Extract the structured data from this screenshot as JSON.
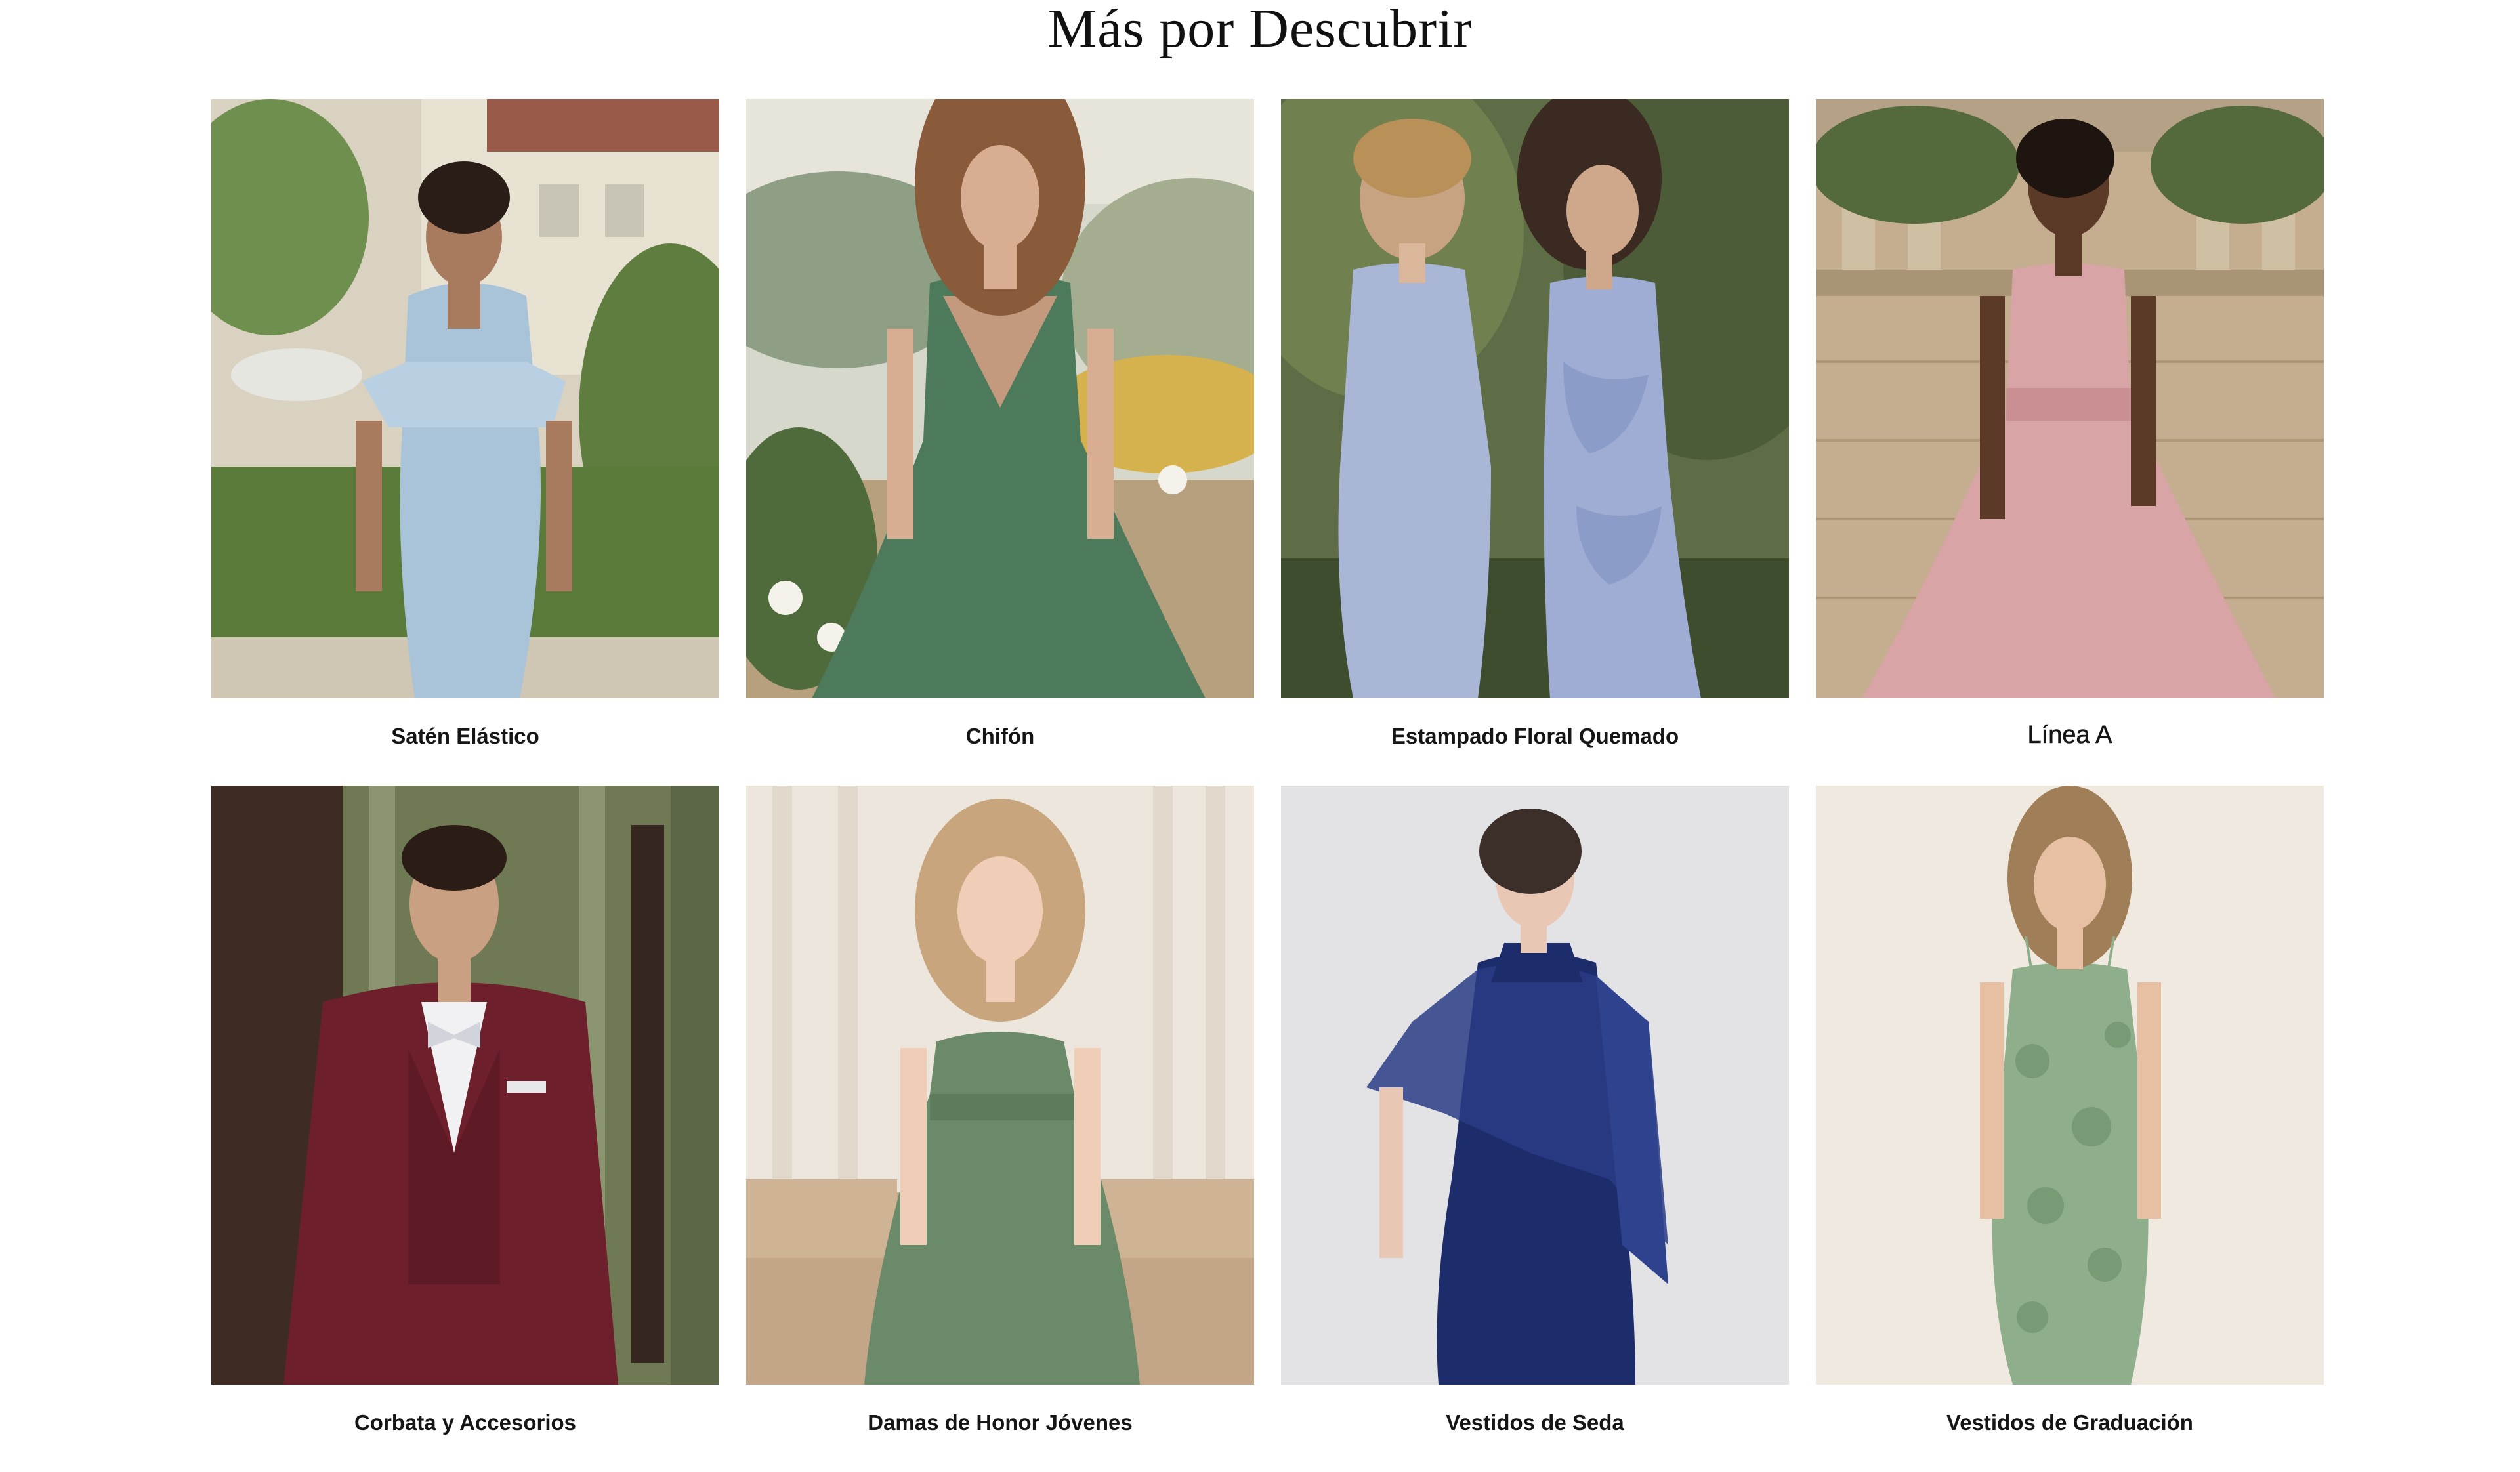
{
  "section": {
    "title": "Más por Descubrir"
  },
  "cards": [
    {
      "label": "Satén Elástico",
      "image": "model-dusty-blue-satin-off-shoulder-dress",
      "colors": {
        "background": "#c9b79a",
        "garment": "#a9c3d9",
        "accent": "#6f8f4e"
      }
    },
    {
      "label": "Chifón",
      "image": "model-green-chiffon-pleated-dress",
      "colors": {
        "background": "#b9c4b5",
        "garment": "#4c7a5b",
        "accent": "#e9e4d6"
      }
    },
    {
      "label": "Estampado Floral Quemado",
      "image": "two-models-lavender-blue-dresses",
      "colors": {
        "background": "#5f6d46",
        "garment": "#aab6d6",
        "accent": "#8c9cc8"
      }
    },
    {
      "label": "Línea A",
      "image": "model-blush-pink-one-shoulder-dress",
      "colors": {
        "background": "#b9a58a",
        "garment": "#d9a4a6",
        "accent": "#556a3c"
      }
    },
    {
      "label": "Corbata y Accesorios",
      "image": "man-burgundy-suit-bow-tie",
      "colors": {
        "background": "#3e2b24",
        "garment": "#6e1f2c",
        "accent": "#d2d4dc"
      }
    },
    {
      "label": "Damas de Honor Jóvenes",
      "image": "girl-green-halter-dress",
      "colors": {
        "background": "#ece6dc",
        "garment": "#6a8a69",
        "accent": "#c8a57c"
      }
    },
    {
      "label": "Vestidos de Seda",
      "image": "model-navy-silk-dress-with-cape",
      "colors": {
        "background": "#e3e3e6",
        "garment": "#1d2d6b",
        "accent": "#3c2f2a"
      }
    },
    {
      "label": "Vestidos de Graduación",
      "image": "model-sage-green-sequin-gown",
      "colors": {
        "background": "#efe9df",
        "garment": "#8fae8b",
        "accent": "#c9a27a"
      }
    }
  ]
}
